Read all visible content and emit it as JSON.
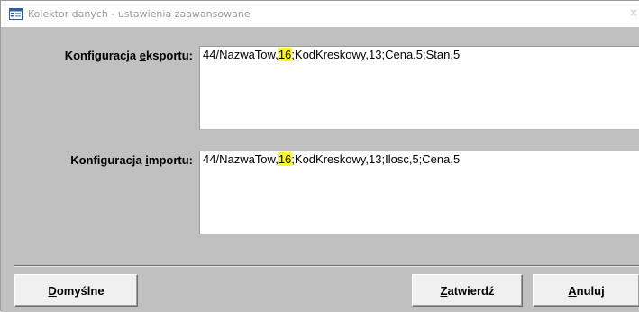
{
  "window": {
    "title": "Kolektor danych - ustawienia zaawansowane",
    "close_glyph": "×"
  },
  "export": {
    "label_pre": "Konfiguracja ",
    "label_accel": "e",
    "label_post": "ksportu:",
    "value_pre": "44/NazwaTow,",
    "value_highlight": "16",
    "value_post": ";KodKreskowy,13;Cena,5;Stan,5"
  },
  "import": {
    "label_pre": "Konfiguracja ",
    "label_accel": "i",
    "label_post": "mportu:",
    "value_pre": "44/NazwaTow,",
    "value_highlight": "16",
    "value_post": ";KodKreskowy,13;Ilosc,5;Cena,5"
  },
  "buttons": {
    "default": {
      "accel": "D",
      "rest": "omyślne"
    },
    "confirm": {
      "accel": "Z",
      "rest": "atwierdź"
    },
    "cancel": {
      "accel": "A",
      "rest": "nuluj"
    }
  },
  "colors": {
    "highlight": "#ffff00",
    "client_bg": "#c0c0c0",
    "title_text": "#9a9a9a"
  },
  "icons": {
    "title": "form-window-icon"
  }
}
